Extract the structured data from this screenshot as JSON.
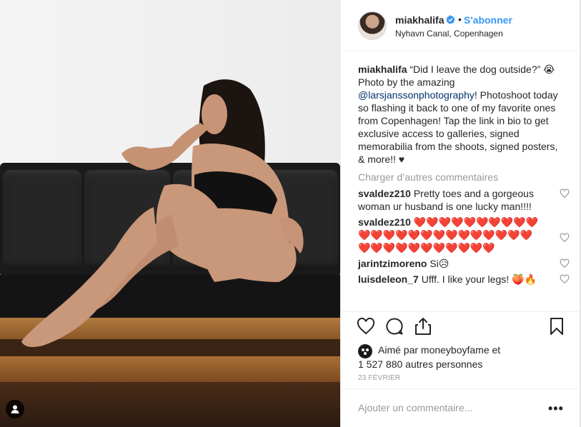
{
  "post": {
    "username": "miakhalifa",
    "verified": true,
    "separator": "•",
    "follow_label": "S'abonner",
    "location": "Nyhavn Canal, Copenhagen"
  },
  "caption": {
    "username": "miakhalifa",
    "text_1": "“Did I leave the dog outside?” 😭 Photo by the amazing ",
    "mention": "@larsjanssonphotography",
    "text_2": "! Photoshoot today so flashing it back to one of my favorite ones from Copenhagen! Tap the link in bio to get exclusive access to galleries, signed memorabilia from the shoots, signed posters, & more!! ♥"
  },
  "load_more_label": "Charger d’autres commentaires",
  "comments": [
    {
      "username": "svaldez210",
      "text": "Pretty toes and a gorgeous woman ur husband is one lucky man!!!!"
    },
    {
      "username": "svaldez210",
      "text": "❤️❤️❤️❤️❤️❤️❤️❤️❤️❤️❤️❤️❤️❤️❤️❤️❤️❤️❤️❤️❤️❤️❤️❤️❤️❤️❤️❤️❤️❤️❤️❤️❤️❤️❤️"
    },
    {
      "username": "jarintzimoreno",
      "text": "Si😥"
    },
    {
      "username": "luisdeleon_7",
      "text": "Ufff. I like your legs! 🍑🔥"
    }
  ],
  "likes": {
    "line_1": "Aimé par moneyboyfame et",
    "line_2": "1 527 880 autres personnes"
  },
  "date": "23 FÉVRIER",
  "add_comment_placeholder": "Ajouter un commentaire...",
  "more_label": "•••",
  "icons": {
    "like": "heart-icon",
    "comment": "comment-icon",
    "share": "share-icon",
    "save": "bookmark-icon",
    "verified": "verified-badge-icon",
    "user_tag": "user-tag-icon"
  },
  "colors": {
    "link": "#3897f0",
    "heart_red": "#ed4956",
    "muted": "#999999"
  }
}
